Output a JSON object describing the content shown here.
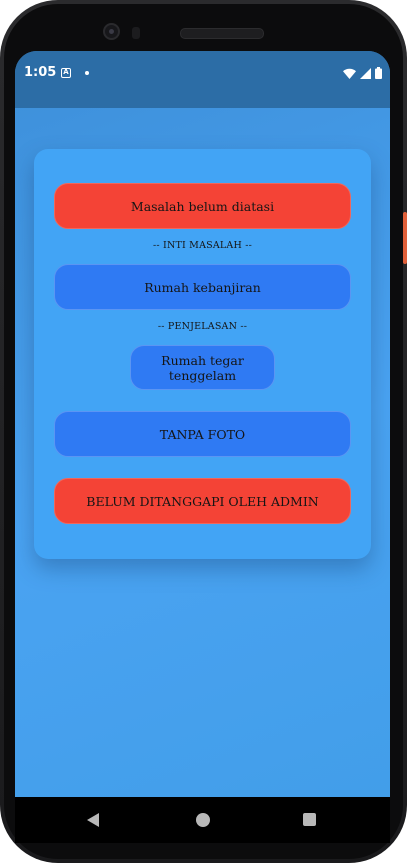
{
  "status_bar": {
    "time": "1:05",
    "notification_icon": "a-icon",
    "dot_icon": "notification-dot-icon",
    "right_icons": [
      "wifi-icon",
      "signal-icon",
      "battery-icon"
    ]
  },
  "report_card": {
    "status_top": "Masalah belum diatasi",
    "core_issue_label": "-- INTI MASALAH --",
    "core_issue_value": "Rumah kebanjiran",
    "explanation_label": "-- PENJELASAN --",
    "explanation_value": "Rumah tegar tenggelam",
    "photo_status": "TANPA FOTO",
    "admin_status": "BELUM DITANGGAPI OLEH ADMIN"
  },
  "colors": {
    "status_bar": "#2c6da6",
    "background": "#4aa3f2",
    "card": "#42a4f5",
    "red_pill": "#f44336",
    "blue_pill": "#2f7af3"
  },
  "nav_bar": {
    "icons": [
      "back-icon",
      "home-icon",
      "recents-icon"
    ]
  }
}
